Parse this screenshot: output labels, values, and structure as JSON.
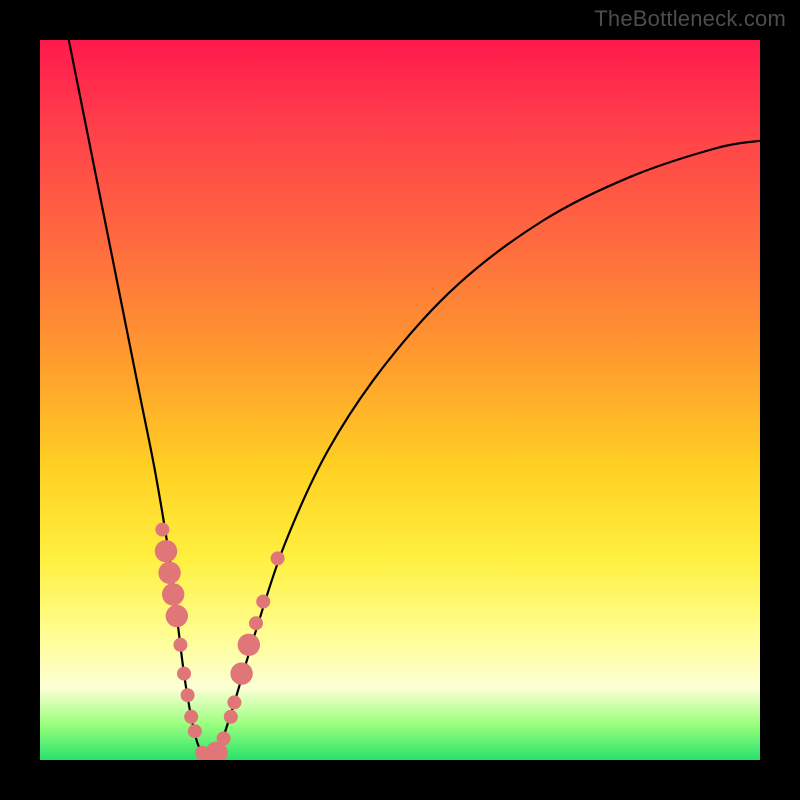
{
  "watermark": "TheBottleneck.com",
  "chart_data": {
    "type": "line",
    "title": "",
    "xlabel": "",
    "ylabel": "",
    "xlim": [
      0,
      100
    ],
    "ylim": [
      0,
      100
    ],
    "series": [
      {
        "name": "bottleneck-curve",
        "x": [
          4,
          6,
          8,
          10,
          12,
          14,
          16,
          18,
          19,
          20,
          21,
          22,
          23.5,
          25,
          27,
          30,
          34,
          40,
          48,
          58,
          70,
          82,
          94,
          100
        ],
        "values": [
          100,
          90,
          80,
          70,
          60,
          50,
          40,
          28,
          20,
          12,
          6,
          2,
          0,
          2,
          8,
          18,
          30,
          43,
          55,
          66,
          75,
          81,
          85,
          86
        ]
      }
    ],
    "markers": {
      "name": "highlight-dots",
      "color": "#e07678",
      "points": [
        {
          "x": 17.0,
          "y": 32.0,
          "r": 1.0
        },
        {
          "x": 17.5,
          "y": 29.0,
          "r": 1.6
        },
        {
          "x": 18.0,
          "y": 26.0,
          "r": 1.6
        },
        {
          "x": 18.5,
          "y": 23.0,
          "r": 1.6
        },
        {
          "x": 19.0,
          "y": 20.0,
          "r": 1.6
        },
        {
          "x": 19.5,
          "y": 16.0,
          "r": 1.0
        },
        {
          "x": 20.0,
          "y": 12.0,
          "r": 1.0
        },
        {
          "x": 20.5,
          "y": 9.0,
          "r": 1.0
        },
        {
          "x": 21.0,
          "y": 6.0,
          "r": 1.0
        },
        {
          "x": 21.5,
          "y": 4.0,
          "r": 1.0
        },
        {
          "x": 22.5,
          "y": 1.0,
          "r": 1.0
        },
        {
          "x": 23.5,
          "y": 0.2,
          "r": 1.6
        },
        {
          "x": 24.5,
          "y": 1.0,
          "r": 1.6
        },
        {
          "x": 25.5,
          "y": 3.0,
          "r": 1.0
        },
        {
          "x": 26.5,
          "y": 6.0,
          "r": 1.0
        },
        {
          "x": 27.0,
          "y": 8.0,
          "r": 1.0
        },
        {
          "x": 28.0,
          "y": 12.0,
          "r": 1.6
        },
        {
          "x": 29.0,
          "y": 16.0,
          "r": 1.6
        },
        {
          "x": 30.0,
          "y": 19.0,
          "r": 1.0
        },
        {
          "x": 31.0,
          "y": 22.0,
          "r": 1.0
        },
        {
          "x": 33.0,
          "y": 28.0,
          "r": 1.0
        }
      ]
    },
    "gradient_stops": [
      {
        "pos": 0.0,
        "color": "#ff1a4d"
      },
      {
        "pos": 0.12,
        "color": "#ff3f4a"
      },
      {
        "pos": 0.28,
        "color": "#ff6a3f"
      },
      {
        "pos": 0.44,
        "color": "#ff9a2e"
      },
      {
        "pos": 0.6,
        "color": "#ffd223"
      },
      {
        "pos": 0.72,
        "color": "#fff040"
      },
      {
        "pos": 0.82,
        "color": "#fffd8d"
      },
      {
        "pos": 0.9,
        "color": "#fcffd4"
      },
      {
        "pos": 0.95,
        "color": "#9bff7e"
      },
      {
        "pos": 1.0,
        "color": "#28e26a"
      }
    ]
  }
}
